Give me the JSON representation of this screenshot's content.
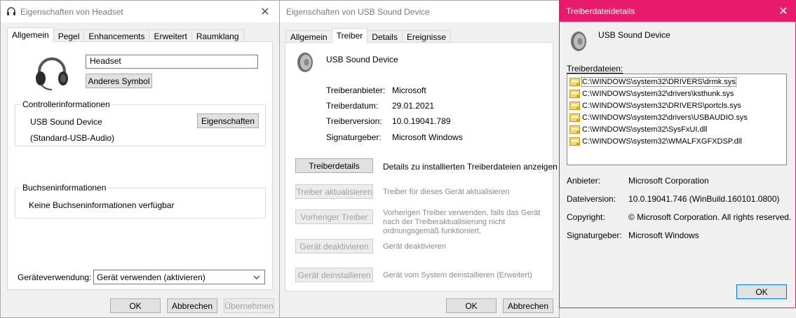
{
  "headset_dialog": {
    "title": "Eigenschaften von Headset",
    "tabs": [
      "Allgemein",
      "Pegel",
      "Enhancements",
      "Erweitert",
      "Raumklang"
    ],
    "name_value": "Headset",
    "change_icon_label": "Anderes Symbol",
    "controller_group_title": "Controllerinformationen",
    "controller_name": "USB Sound Device",
    "controller_type": "(Standard-USB-Audio)",
    "properties_label": "Eigenschaften",
    "jack_group_title": "Buchseninformationen",
    "jack_info": "Keine Buchseninformationen verfügbar",
    "usage_label": "Geräteverwendung:",
    "usage_value": "Gerät verwenden (aktivieren)",
    "ok_label": "OK",
    "cancel_label": "Abbrechen",
    "apply_label": "Übernehmen"
  },
  "usb_dialog": {
    "title": "Eigenschaften von USB Sound Device",
    "tabs": [
      "Allgemein",
      "Treiber",
      "Details",
      "Ereignisse"
    ],
    "device_name": "USB Sound Device",
    "info": [
      {
        "label": "Treiberanbieter:",
        "value": "Microsoft"
      },
      {
        "label": "Treiberdatum:",
        "value": "29.01.2021"
      },
      {
        "label": "Treiberversion:",
        "value": "10.0.19041.789"
      },
      {
        "label": "Signaturgeber:",
        "value": "Microsoft Windows"
      }
    ],
    "actions": [
      {
        "button": "Treiberdetails",
        "desc": "Details zu installierten Treiberdateien anzeigen",
        "enabled": true
      },
      {
        "button": "Treiber aktualisieren",
        "desc": "Treiber für dieses Gerät aktualisieren",
        "enabled": false
      },
      {
        "button": "Vorheriger Treiber",
        "desc": "Vorherigen Treiber verwenden, falls das Gerät nach der Treiberaktualisierung nicht ordnungsgemäß funktioniert.",
        "enabled": false
      },
      {
        "button": "Gerät deaktivieren",
        "desc": "Gerät deaktivieren",
        "enabled": false
      },
      {
        "button": "Gerät deinstallieren",
        "desc": "Gerät vom System deinstallieren (Erweitert)",
        "enabled": false
      }
    ],
    "ok_label": "OK",
    "cancel_label": "Abbrechen"
  },
  "details_dialog": {
    "title": "Treiberdateidetails",
    "device_name": "USB Sound Device",
    "files_label": "Treiberdateien:",
    "files": [
      "C:\\WINDOWS\\system32\\DRIVERS\\drmk.sys",
      "C:\\WINDOWS\\system32\\drivers\\ksthunk.sys",
      "C:\\WINDOWS\\system32\\DRIVERS\\portcls.sys",
      "C:\\WINDOWS\\system32\\drivers\\USBAUDIO.sys",
      "C:\\WINDOWS\\system32\\SysFxUI.dll",
      "C:\\WINDOWS\\system32\\WMALFXGFXDSP.dll"
    ],
    "info": [
      {
        "label": "Anbieter:",
        "value": "Microsoft Corporation"
      },
      {
        "label": "Dateiversion:",
        "value": "10.0.19041.746 (WinBuild.160101.0800)"
      },
      {
        "label": "Copyright:",
        "value": "© Microsoft Corporation. All rights reserved."
      },
      {
        "label": "Signaturgeber:",
        "value": "Microsoft Windows"
      }
    ],
    "ok_label": "OK",
    "accent_color": "#e81a6b"
  }
}
